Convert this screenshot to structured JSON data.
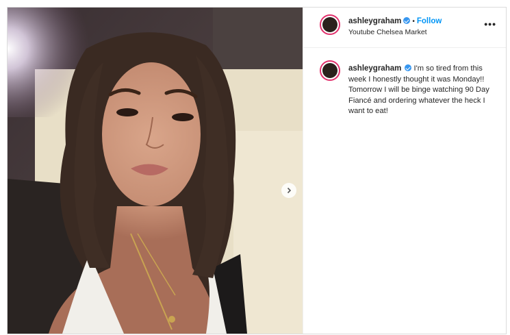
{
  "post": {
    "username": "ashleygraham",
    "follow_label": "Follow",
    "separator": "•",
    "location": "Youtube Chelsea Market",
    "more_label": "•••",
    "caption": "I'm so tired from this week I honestly thought it was Monday!! Tomorrow I will be binge watching 90 Day Fiancé and ordering whatever the heck I want to eat!"
  },
  "colors": {
    "verified": "#3897f0",
    "follow": "#0095f6",
    "story_ring": "#e1306c"
  },
  "icons": {
    "verified": "verified-badge-icon",
    "next": "chevron-right-icon",
    "more": "more-options-icon"
  }
}
